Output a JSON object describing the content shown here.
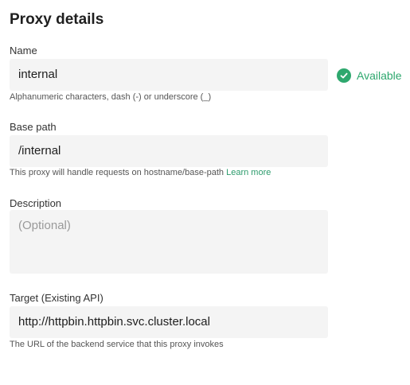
{
  "section": {
    "title": "Proxy details"
  },
  "name_field": {
    "label": "Name",
    "value": "internal",
    "hint": "Alphanumeric characters, dash (-) or underscore (_)",
    "status_text": "Available",
    "status_icon": "check-circle-icon",
    "status_color": "#2ea86e"
  },
  "base_path_field": {
    "label": "Base path",
    "value": "/internal",
    "hint": "This proxy will handle requests on hostname/base-path",
    "hint_link": "Learn more"
  },
  "description_field": {
    "label": "Description",
    "placeholder": "(Optional)",
    "value": ""
  },
  "target_field": {
    "label": "Target (Existing API)",
    "value": "http://httpbin.httpbin.svc.cluster.local",
    "hint": "The URL of the backend service that this proxy invokes"
  }
}
